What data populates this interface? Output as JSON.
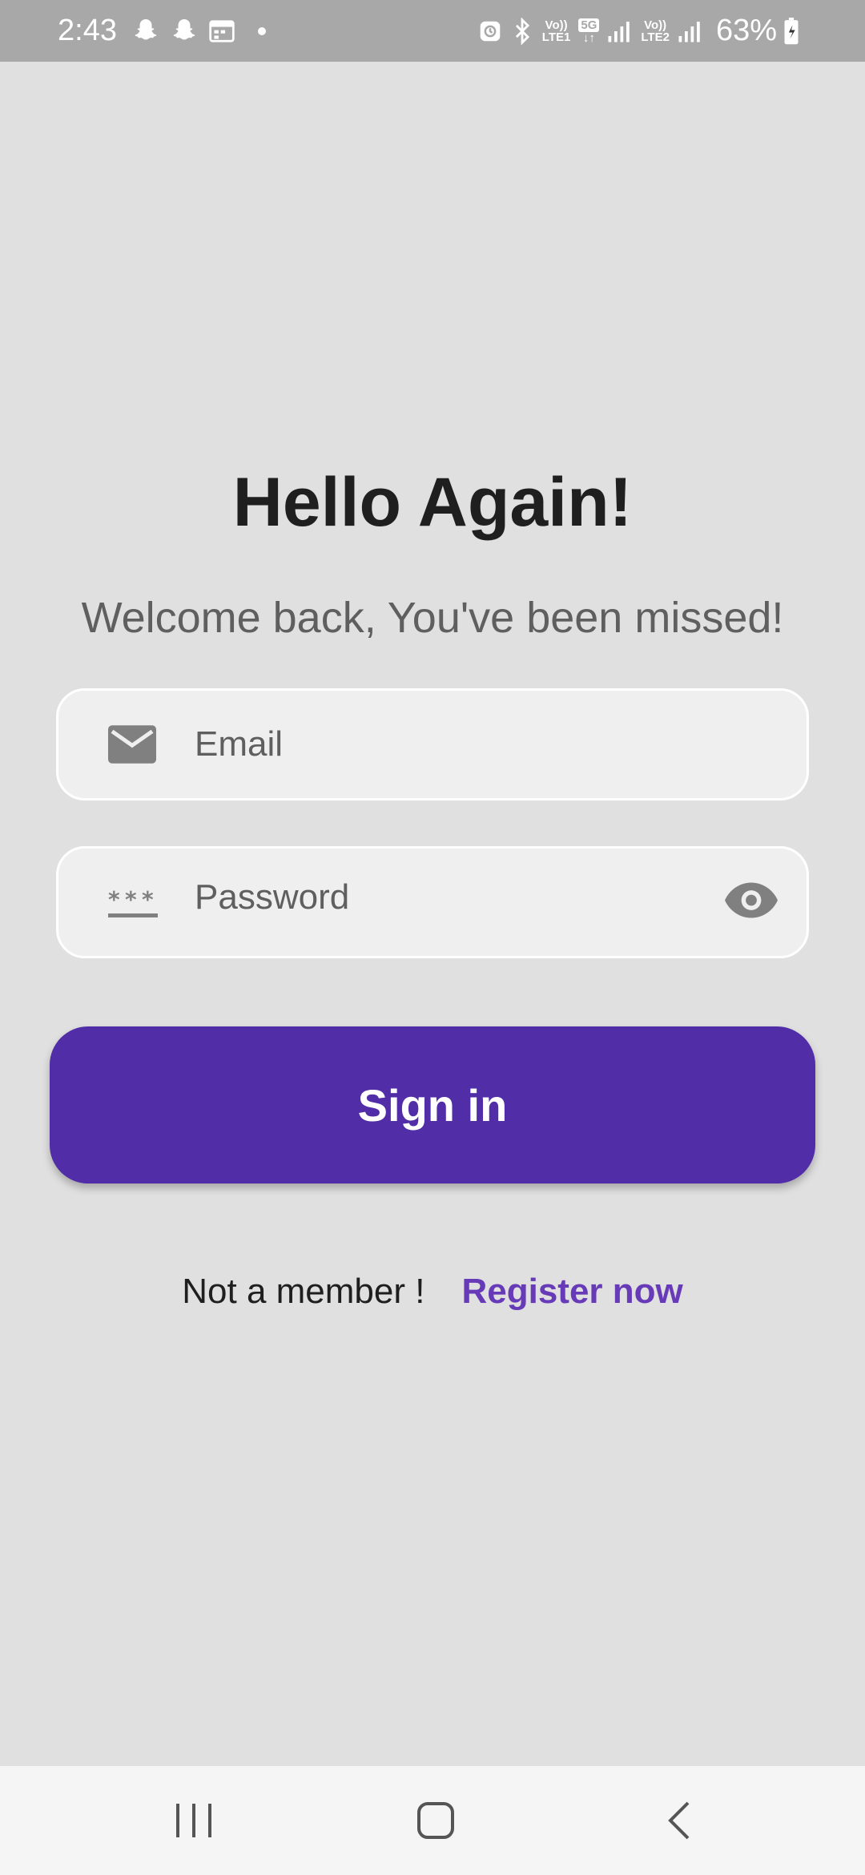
{
  "status_bar": {
    "time": "2:43",
    "notification_icons": [
      "snapchat-icon",
      "snapchat-icon",
      "calendar-icon",
      "dot-icon"
    ],
    "system_icons": [
      "alarm-icon",
      "bluetooth-icon",
      "signal-icon",
      "battery-charging-icon"
    ],
    "sim1_label_top": "Vo))",
    "sim1_label_bottom": "LTE1",
    "network_label": "5G",
    "sim2_label_top": "Vo))",
    "sim2_label_bottom": "LTE2",
    "battery": "63%"
  },
  "login": {
    "title": "Hello Again!",
    "subtitle": "Welcome back, You've been missed!",
    "email": {
      "placeholder": "Email",
      "value": "",
      "icon": "mail-icon"
    },
    "password": {
      "placeholder": "Password",
      "value": "",
      "icon": "password-icon",
      "toggle_icon": "eye-icon"
    },
    "signin_label": "Sign in",
    "not_member_text": "Not a member !",
    "register_label": "Register now"
  },
  "colors": {
    "background": "#e0e0e0",
    "primary": "#512da8",
    "link": "#673ab7",
    "status_bar": "#a8a8a8"
  },
  "nav_bar": {
    "buttons": [
      "recents-icon",
      "home-icon",
      "back-icon"
    ]
  }
}
